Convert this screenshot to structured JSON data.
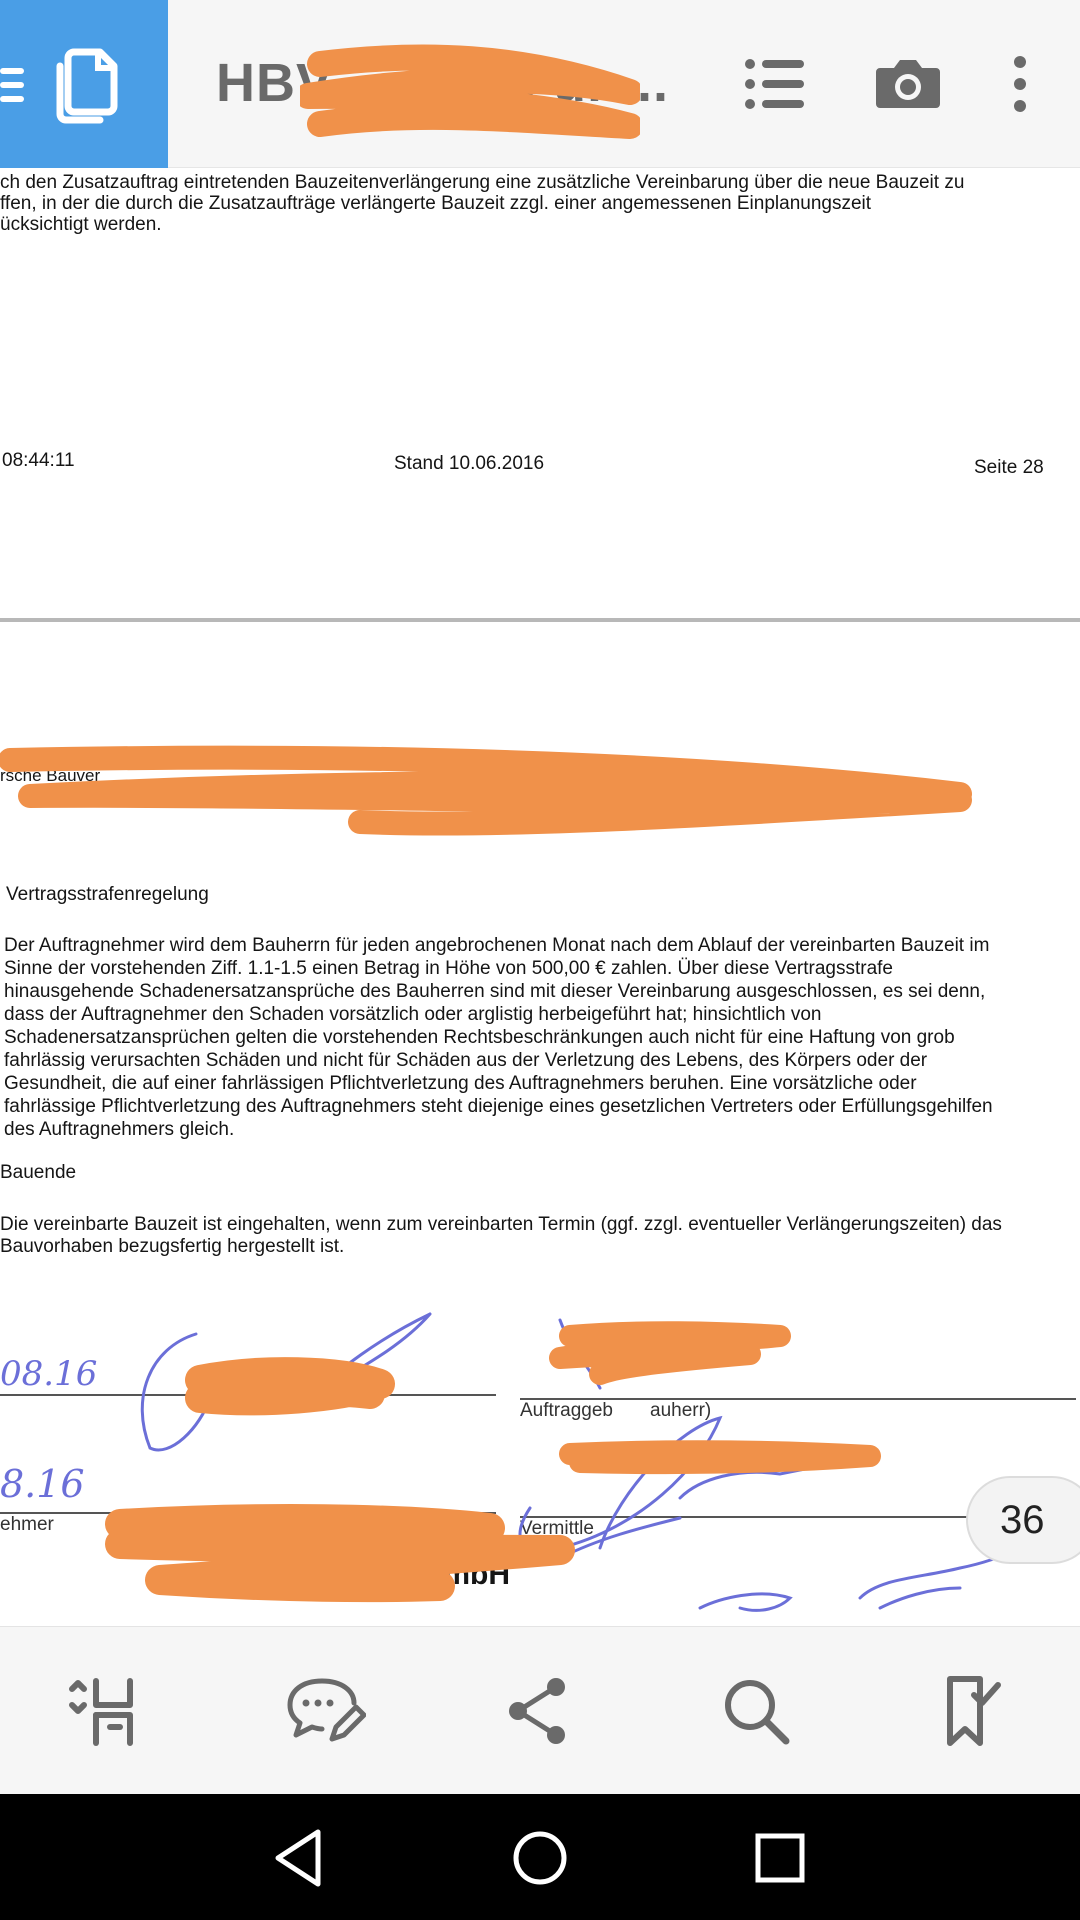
{
  "header": {
    "title": "HBV",
    "title_suffix": "n un...",
    "accent_color": "#4a9ee6",
    "icons": [
      "documents-icon",
      "outline-list-icon",
      "camera-icon",
      "more-vert-icon"
    ]
  },
  "document": {
    "paragraph_top": "ch den Zusatzauftrag eintretenden Bauzeitenverlängerung eine zusätzliche Vereinbarung über die neue Bauzeit zu\nffen, in der die durch die Zusatzaufträge verlängerte Bauzeit zzgl. einer angemessenen Einplanungszeit\nücksichtigt werden.",
    "footer_time": "08:44:11",
    "footer_stand": "Stand 10.06.2016",
    "footer_page": "Seite 28",
    "redacted_header_text": "rsche Bauver",
    "section_vertrag_title": "Vertragsstrafenregelung",
    "section_vertrag_text": "Der Auftragnehmer wird dem Bauherrn für jeden angebrochenen Monat nach dem Ablauf der vereinbarten Bauzeit im\nSinne der vorstehenden Ziff. 1.1-1.5 einen Betrag in Höhe von 500,00 € zahlen. Über diese Vertragsstrafe\nhinausgehende Schadenersatzansprüche des Bauherren sind mit dieser Vereinbarung ausgeschlossen, es sei denn,\ndass der Auftragnehmer den Schaden vorsätzlich oder arglistig herbeigeführt hat; hinsichtlich von\nSchadenersatzansprüchen gelten die vorstehenden Rechtsbeschränkungen auch nicht für eine Haftung von grob\nfahrlässig verursachten Schäden und nicht für Schäden aus der Verletzung des Lebens, des Körpers oder der\nGesundheit, die auf einer fahrlässigen Pflichtverletzung des Auftragnehmers beruhen. Eine vorsätzliche oder\nfahrlässige Pflichtverletzung des Auftragnehmers steht diejenige eines gesetzlichen Vertreters oder Erfüllungsgehilfen\ndes Auftragnehmers gleich.",
    "section_bauende_title": "Bauende",
    "section_bauende_text": "Die vereinbarte Bauzeit ist eingehalten, wenn zum vereinbarten Termin (ggf. zzgl. eventueller Verlängerungszeiten) das\nBauvorhaben bezugsfertig hergestellt ist.",
    "sig_date_1": "08.16",
    "sig_date_2": "8.16",
    "sig_label_auftraggeber": "Auftraggeber (Bauherr)",
    "sig_label_auftraggeber_visible": "Auftraggeb",
    "sig_label_auftraggeber_end": "auherr)",
    "sig_label_auftragnehmer": "ehmer",
    "sig_label_vermittler": "Vermittle",
    "company_suffix": "GmbH",
    "redaction_color": "#f0914a",
    "ink_color": "#6b6fd8"
  },
  "page_indicator": "36",
  "bottom_toolbar": {
    "icons": [
      "reflow-view-icon",
      "comment-edit-icon",
      "share-icon",
      "search-icon",
      "bookmark-check-icon"
    ]
  },
  "system_nav": {
    "icons": [
      "back-icon",
      "home-icon",
      "recents-icon"
    ]
  }
}
